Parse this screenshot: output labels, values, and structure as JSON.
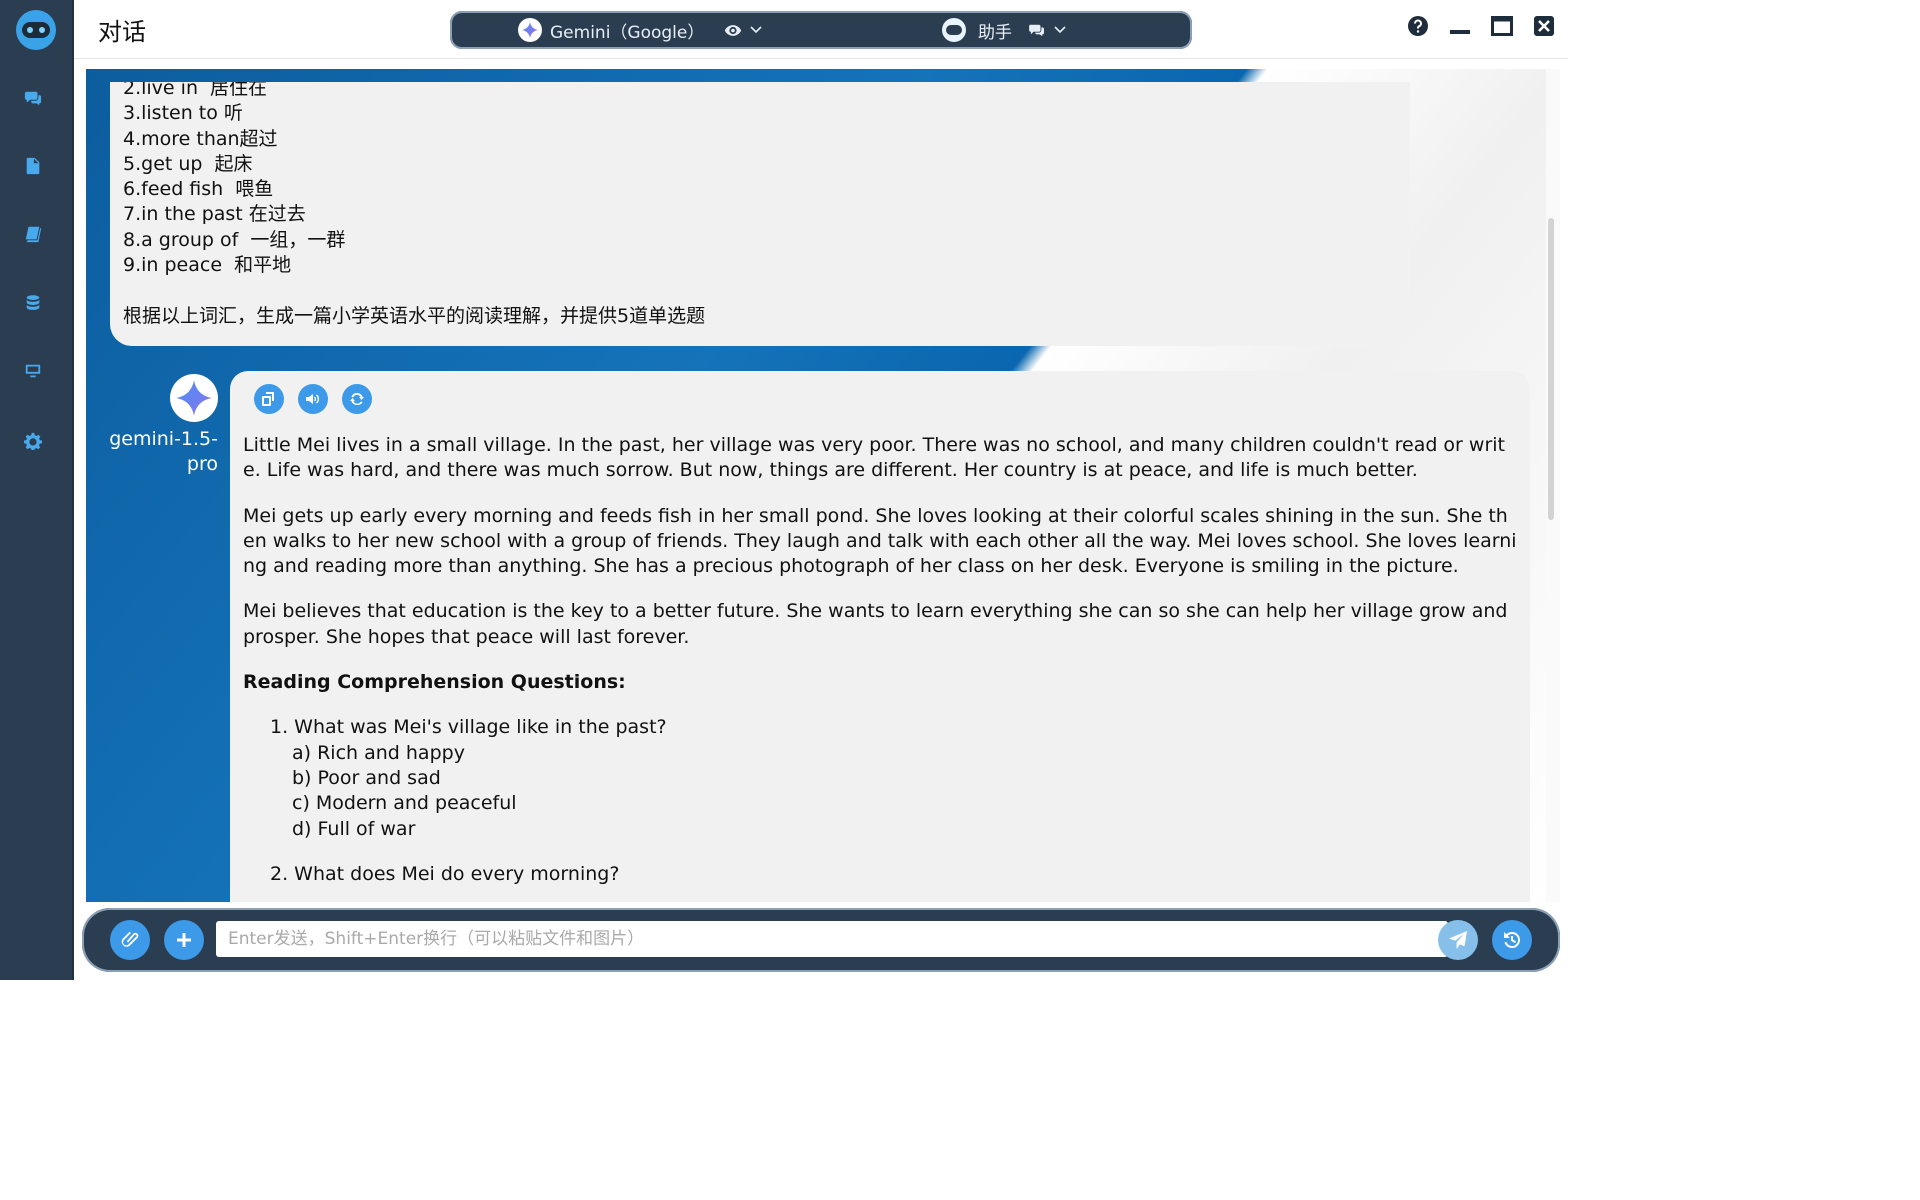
{
  "header": {
    "title": "对话",
    "model_label": "Gemini（Google）",
    "assistant_label": "助手"
  },
  "user_message": {
    "lines": [
      "2.live in  居住在",
      "3.listen to 听",
      "4.more than超过",
      "5.get up  起床",
      "6.feed fish  喂鱼",
      "7.in the past 在过去",
      "8.a group of  一组，一群",
      "9.in peace  和平地",
      "",
      "根据以上词汇，生成一篇小学英语水平的阅读理解，并提供5道单选题"
    ]
  },
  "assistant_message": {
    "model_name": "gemini-1.5-pro",
    "paragraphs": [
      "Little Mei lives in a small village. In the past, her village was very poor. There was no school, and many children couldn't read or write. Life was hard, and there was much sorrow. But now, things are different. Her country is at peace, and life is much better.",
      "Mei gets up early every morning and feeds fish in her small pond. She loves looking at their colorful scales shining in the sun. She then walks to her new school with a group of friends. They laugh and talk with each other all the way. Mei loves school. She loves learning and reading more than anything. She has a precious photograph of her class on her desk. Everyone is smiling in the picture.",
      "Mei believes that education is the key to a better future. She wants to learn everything she can so she can help her village grow and prosper. She hopes that peace will last forever."
    ],
    "questions_heading": "Reading Comprehension Questions:",
    "questions": [
      {
        "text": "1. What was Mei's village like in the past?",
        "options": [
          "a) Rich and happy",
          "b) Poor and sad",
          "c) Modern and peaceful",
          "d) Full of war"
        ]
      },
      {
        "text": "2. What does Mei do every morning?",
        "options": []
      }
    ]
  },
  "input": {
    "placeholder": "Enter发送，Shift+Enter换行（可以粘贴文件和图片）",
    "value": ""
  },
  "colors": {
    "sidebar": "#2b3d51",
    "accent": "#3c9ae8",
    "bubble": "#f1f1f1"
  },
  "icons": {
    "sidebar": [
      "chat-icon",
      "document-icon",
      "book-icon",
      "database-icon",
      "monitor-icon",
      "settings-icon"
    ],
    "header": [
      "help-icon",
      "minimize-icon",
      "maximize-icon",
      "close-icon"
    ],
    "actions": [
      "copy-icon",
      "speaker-icon",
      "regenerate-icon"
    ],
    "input": [
      "attach-icon",
      "add-icon",
      "send-icon",
      "history-icon"
    ]
  }
}
